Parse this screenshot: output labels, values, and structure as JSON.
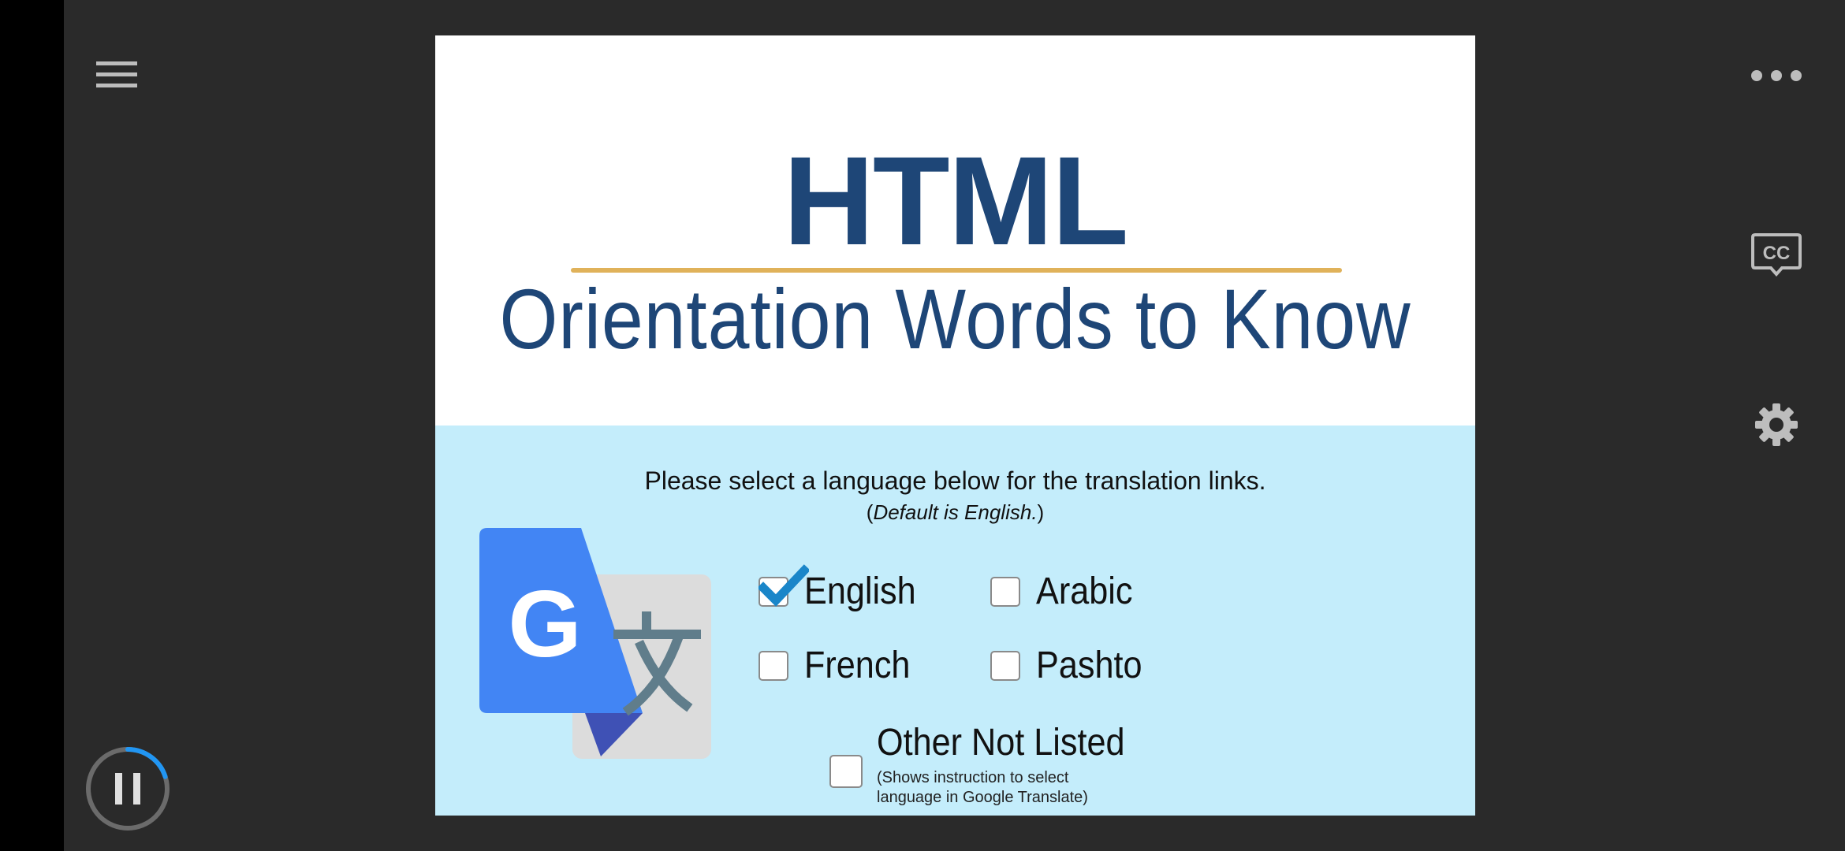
{
  "player": {
    "icons": {
      "menu": "hamburger-menu-icon",
      "more": "more-options-icon",
      "captions": "closed-captions-icon",
      "settings": "gear-icon",
      "playback": "pause-icon"
    },
    "captions_label": "CC",
    "playback_progress": 0.2
  },
  "slide": {
    "title": "HTML",
    "subtitle": "Orientation Words to Know",
    "instruction": "Please select a language below for the translation links.",
    "default_note_prefix": "(",
    "default_note": "Default is English.",
    "default_note_suffix": ")",
    "logo": "google-translate-logo",
    "languages": [
      {
        "label": "English",
        "checked": true
      },
      {
        "label": "Arabic",
        "checked": false
      },
      {
        "label": "French",
        "checked": false
      },
      {
        "label": "Pashto",
        "checked": false
      }
    ],
    "other": {
      "label": "Other Not Listed",
      "checked": false,
      "note": "(Shows instruction to select language in Google Translate)"
    }
  },
  "colors": {
    "background": "#2a2a2a",
    "title": "#1e4677",
    "rule": "#e0b25a",
    "panel": "#c4edfb",
    "check": "#1a86c9"
  }
}
